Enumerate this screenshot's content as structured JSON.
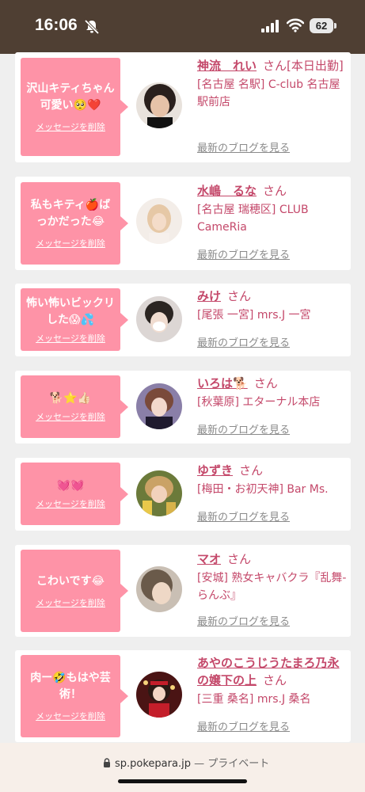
{
  "status": {
    "time": "16:06",
    "battery": "62"
  },
  "delete_label": "メッセージを削除",
  "blog_label": "最新のブログを見る",
  "honorific": "さん",
  "cards": [
    {
      "message": "沢山キティちゃん可愛い🥺❤️",
      "name": "神流　れい",
      "shop": "[名古屋 名駅] C-club 名古屋駅前店",
      "avatar_tone": "#3b2f2c"
    },
    {
      "message": "私もキティ🍎ばっかだった😂",
      "name": "水嶋　るな",
      "shop": "[名古屋 瑞穂区] CLUB CameRia",
      "avatar_tone": "#e9d8c8"
    },
    {
      "message": "怖い怖いビックリした😱💦",
      "name": "みけ",
      "shop": "[尾張 一宮] mrs.J 一宮",
      "avatar_tone": "#d7d2d0"
    },
    {
      "message": "🐕⭐👍🏻",
      "name": "いろは🐕",
      "shop": "[秋葉原] エターナル本店",
      "avatar_tone": "#6a5a8a"
    },
    {
      "message": "💓💓",
      "name": "ゆずき",
      "shop": "[梅田・お初天神] Bar Ms.",
      "avatar_tone": "#b8942e"
    },
    {
      "message": "こわいです😂",
      "name": "マオ",
      "shop": "[安城] 熟女キャバクラ『乱舞-らんぶ』",
      "avatar_tone": "#9b8b7a"
    },
    {
      "message": "肉ー🤣もはや芸術！",
      "name": "あやのこうじうたまろ乃永の嬢下の上",
      "shop": "[三重 桑名] mrs.J 桑名",
      "avatar_tone": "#6b1a1a"
    }
  ],
  "footer": {
    "url": "sp.pokepara.jp",
    "separator": " — ",
    "private_label": "プライベート"
  }
}
